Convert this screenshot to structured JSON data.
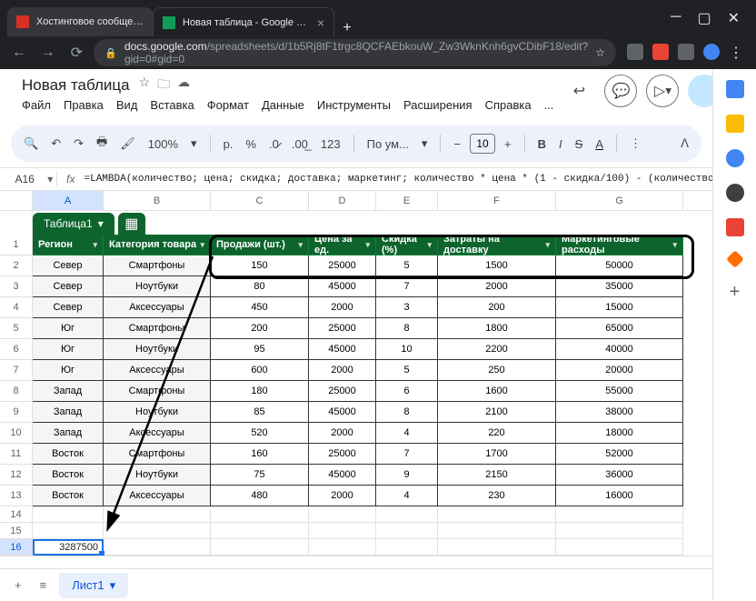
{
  "browser": {
    "tab1_title": "Хостинговое сообщество «Tim",
    "tab2_title": "Новая таблица - Google Табли",
    "url_domain": "docs.google.com",
    "url_path": "/spreadsheets/d/1b5Rj8tF1trgc8QCFAEbkouW_Zw3WknKnh6gvCDibF18/edit?gid=0#gid=0"
  },
  "doc": {
    "title": "Новая таблица",
    "menus": [
      "Файл",
      "Правка",
      "Вид",
      "Вставка",
      "Формат",
      "Данные",
      "Инструменты",
      "Расширения",
      "Справка",
      "..."
    ]
  },
  "toolbar": {
    "zoom": "100%",
    "currency_rub": "р.",
    "percent": "%",
    "dec_dec": ".0̷",
    "dec_inc": ".00̲",
    "num123": "123",
    "font": "По ум...",
    "font_size": "10"
  },
  "formula": {
    "name_box": "A16",
    "fx": "fx",
    "text": "=LAMBDA(количество; цена; скидка; доставка; маркетинг; количество * цена * (1 - скидка/100) - (количество * доставка) -"
  },
  "cols": [
    "A",
    "B",
    "C",
    "D",
    "E",
    "F",
    "G"
  ],
  "table_tab": "Таблица1",
  "headers": [
    "Регион",
    "Категория товара",
    "Продажи (шт.)",
    "Цена за ед.",
    "Скидка (%)",
    "Затраты на доставку",
    "Маркетинговые расходы"
  ],
  "rows": [
    [
      "Север",
      "Смартфоны",
      "150",
      "25000",
      "5",
      "1500",
      "50000"
    ],
    [
      "Север",
      "Ноутбуки",
      "80",
      "45000",
      "7",
      "2000",
      "35000"
    ],
    [
      "Север",
      "Аксессуары",
      "450",
      "2000",
      "3",
      "200",
      "15000"
    ],
    [
      "Юг",
      "Смартфоны",
      "200",
      "25000",
      "8",
      "1800",
      "65000"
    ],
    [
      "Юг",
      "Ноутбуки",
      "95",
      "45000",
      "10",
      "2200",
      "40000"
    ],
    [
      "Юг",
      "Аксессуары",
      "600",
      "2000",
      "5",
      "250",
      "20000"
    ],
    [
      "Запад",
      "Смартфоны",
      "180",
      "25000",
      "6",
      "1600",
      "55000"
    ],
    [
      "Запад",
      "Ноутбуки",
      "85",
      "45000",
      "8",
      "2100",
      "38000"
    ],
    [
      "Запад",
      "Аксессуары",
      "520",
      "2000",
      "4",
      "220",
      "18000"
    ],
    [
      "Восток",
      "Смартфоны",
      "160",
      "25000",
      "7",
      "1700",
      "52000"
    ],
    [
      "Восток",
      "Ноутбуки",
      "75",
      "45000",
      "9",
      "2150",
      "36000"
    ],
    [
      "Восток",
      "Аксессуары",
      "480",
      "2000",
      "4",
      "230",
      "16000"
    ]
  ],
  "result_cell": "3287500",
  "sheet_tab": "Лист1"
}
